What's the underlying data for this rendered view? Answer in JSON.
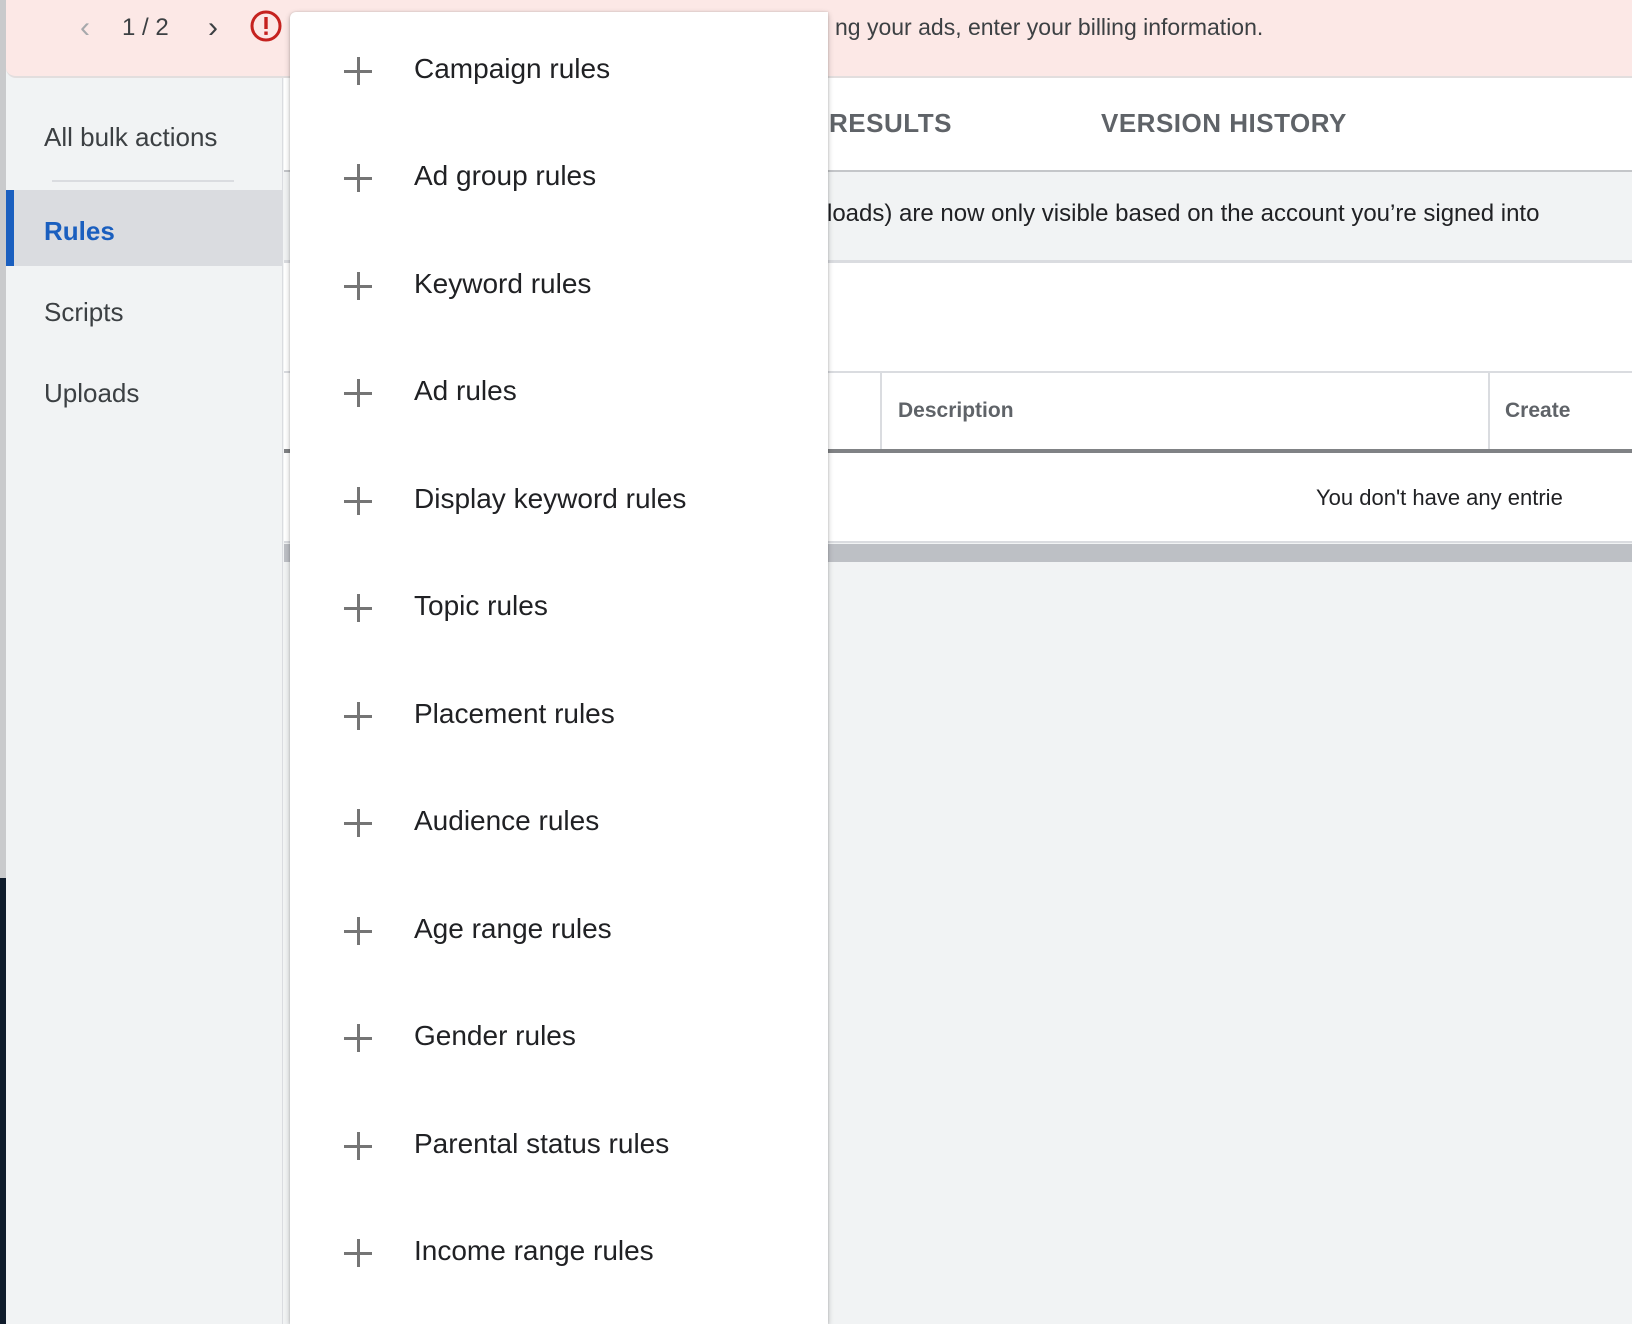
{
  "banner": {
    "pager": {
      "current": "1",
      "separator": "/",
      "total": "2",
      "text": "1 / 2"
    },
    "prev_icon": "chevron-left-icon",
    "next_icon": "chevron-right-icon",
    "alert_icon": "error-circle-icon",
    "message": "ng your ads, enter your billing information.",
    "colors": {
      "background": "#fce8e6",
      "alert": "#c5221f"
    }
  },
  "sidebar": {
    "items": [
      {
        "label": "All bulk actions",
        "active": false
      },
      {
        "label": "Rules",
        "active": true
      },
      {
        "label": "Scripts",
        "active": false
      },
      {
        "label": "Uploads",
        "active": false
      }
    ],
    "accent_color": "#1a5fbf"
  },
  "tabs": [
    {
      "label": "RESULTS"
    },
    {
      "label": "VERSION HISTORY"
    }
  ],
  "info": {
    "text": "loads) are now only visible based on the account you’re signed into"
  },
  "table": {
    "columns": [
      "Description",
      "Create"
    ],
    "empty_message": "You don't have any entrie"
  },
  "menu": {
    "items": [
      {
        "icon": "plus-icon",
        "label": "Campaign rules"
      },
      {
        "icon": "plus-icon",
        "label": "Ad group rules"
      },
      {
        "icon": "plus-icon",
        "label": "Keyword rules"
      },
      {
        "icon": "plus-icon",
        "label": "Ad rules"
      },
      {
        "icon": "plus-icon",
        "label": "Display keyword rules"
      },
      {
        "icon": "plus-icon",
        "label": "Topic rules"
      },
      {
        "icon": "plus-icon",
        "label": "Placement rules"
      },
      {
        "icon": "plus-icon",
        "label": "Audience rules"
      },
      {
        "icon": "plus-icon",
        "label": "Age range rules"
      },
      {
        "icon": "plus-icon",
        "label": "Gender rules"
      },
      {
        "icon": "plus-icon",
        "label": "Parental status rules"
      },
      {
        "icon": "plus-icon",
        "label": "Income range rules"
      }
    ]
  }
}
